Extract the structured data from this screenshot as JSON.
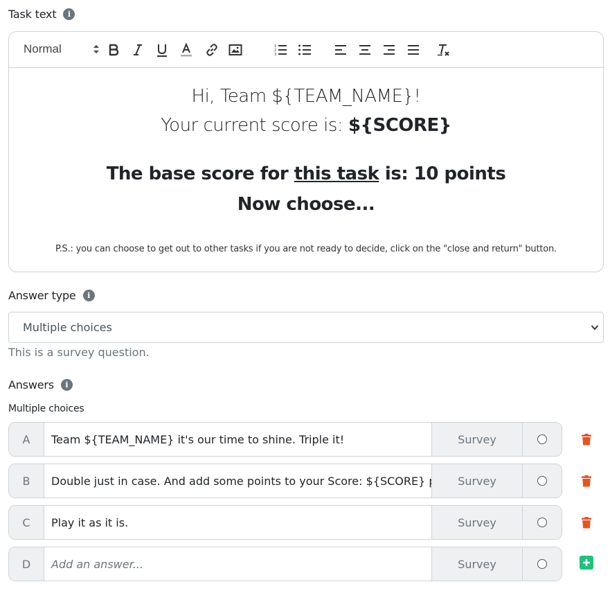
{
  "task_text": {
    "label": "Task text",
    "toolbar": {
      "heading_value": "Normal"
    },
    "content": {
      "line1": "Hi, Team ${TEAM_NAME}!",
      "line2_prefix": "Your current score is: ",
      "line2_bold": "${SCORE}",
      "line3_prefix": "The base score for ",
      "line3_underlined": "this task",
      "line3_suffix": " is: 10 points",
      "line4": "Now choose...",
      "line5": "P.S.: you can choose to get out to other tasks if you are not ready to decide, click on the \"close and return\" button."
    }
  },
  "answer_type": {
    "label": "Answer type",
    "selected": "Multiple choices",
    "hint": "This is a survey question."
  },
  "answers": {
    "label": "Answers",
    "sub_label": "Multiple choices",
    "rows": [
      {
        "letter": "A",
        "text": "Team ${TEAM_NAME} it's our time to shine. Triple it!",
        "kind": "Survey",
        "action": "trash-icon"
      },
      {
        "letter": "B",
        "text": "Double just in case. And add some points to your Score: ${SCORE} point",
        "kind": "Survey",
        "action": "trash-icon"
      },
      {
        "letter": "C",
        "text": "Play it as it is.",
        "kind": "Survey",
        "action": "trash-icon"
      },
      {
        "letter": "D",
        "placeholder": "Add an answer...",
        "kind": "Survey",
        "action": "plus-icon"
      }
    ]
  },
  "colors": {
    "delete": "#e8541e",
    "add": "#1ec27a",
    "border": "#cfd3d7",
    "cell_bg": "#eef0f2"
  }
}
